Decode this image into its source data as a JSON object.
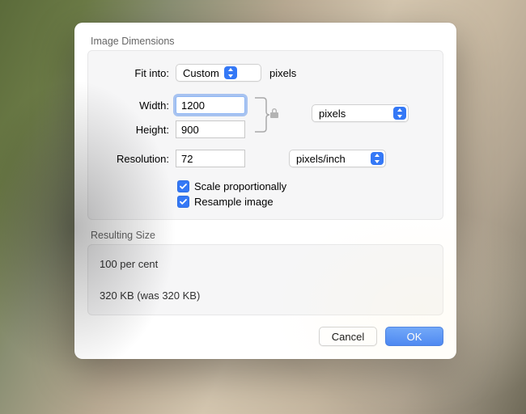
{
  "section": {
    "image_dimensions": "Image Dimensions",
    "resulting_size": "Resulting Size"
  },
  "fit_into": {
    "label": "Fit into:",
    "value": "Custom",
    "unit_label": "pixels"
  },
  "width": {
    "label": "Width:",
    "value": "1200"
  },
  "height": {
    "label": "Height:",
    "value": "900"
  },
  "dim_unit": {
    "value": "pixels"
  },
  "resolution": {
    "label": "Resolution:",
    "value": "72",
    "unit_value": "pixels/inch"
  },
  "checks": {
    "scale_proportionally": "Scale proportionally",
    "resample_image": "Resample image"
  },
  "result": {
    "percent_line": "100 per cent",
    "size_line": "320 KB (was 320 KB)"
  },
  "buttons": {
    "cancel": "Cancel",
    "ok": "OK"
  }
}
